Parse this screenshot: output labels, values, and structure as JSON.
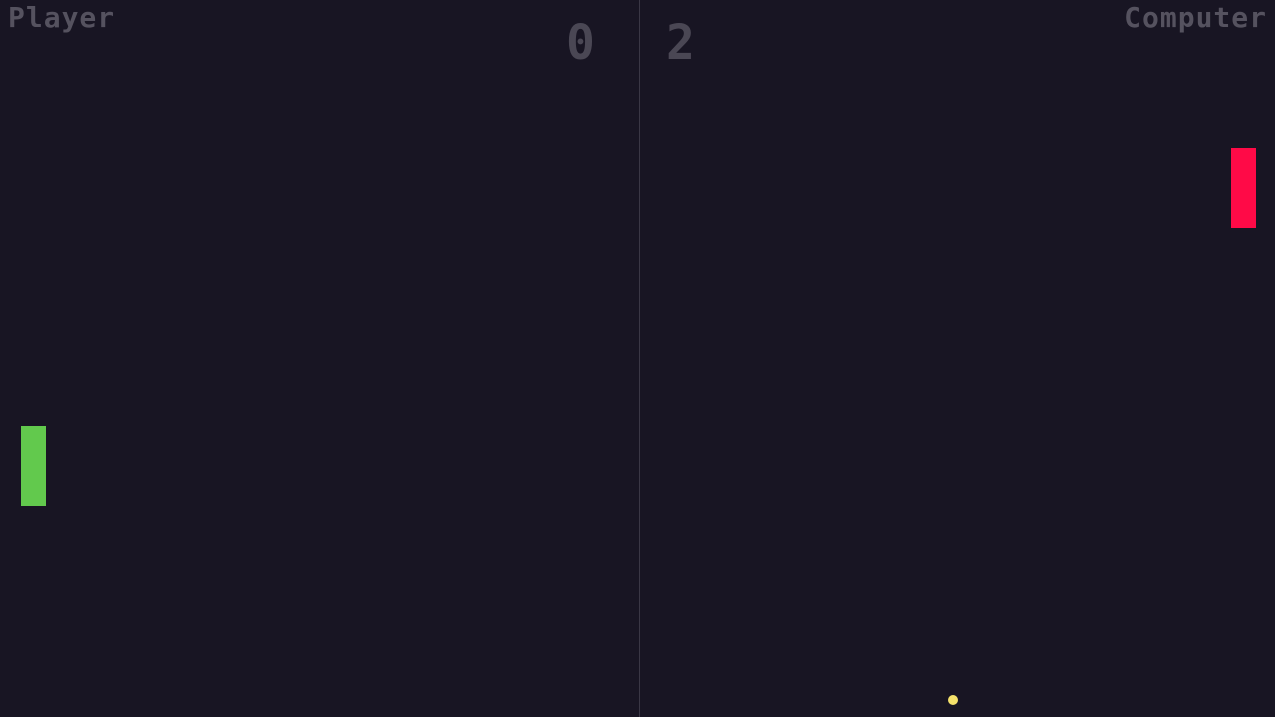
{
  "scoreboard": {
    "player_label": "Player",
    "computer_label": "Computer",
    "player_score": "0",
    "computer_score": "2"
  },
  "colors": {
    "background": "#181523",
    "player_paddle": "#62c94d",
    "computer_paddle": "#ff0a47",
    "ball": "#f5e26b",
    "net": "#3a3745",
    "text": "#55525f"
  }
}
